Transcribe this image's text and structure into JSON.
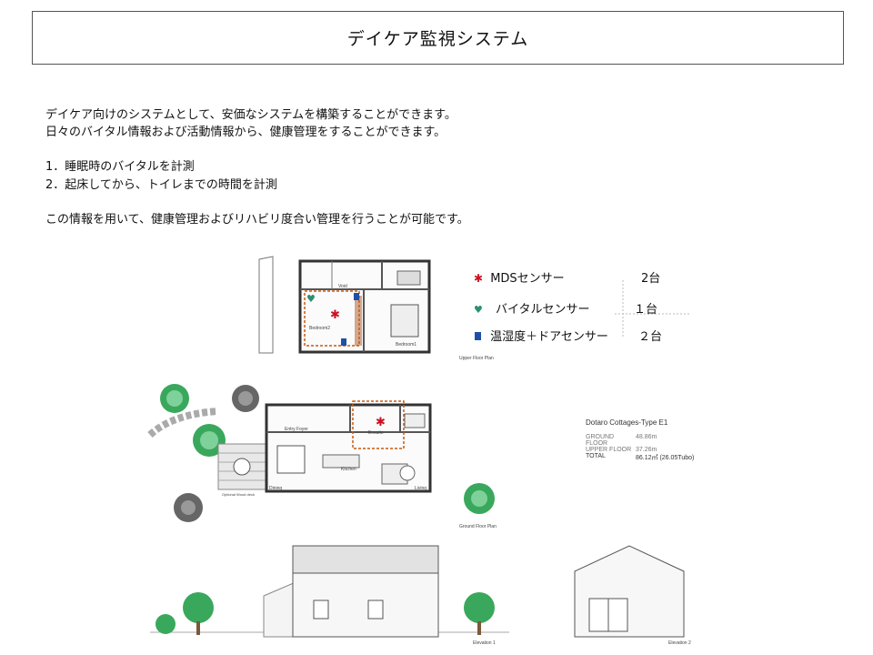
{
  "title": "デイケア監視システム",
  "intro": {
    "line1": "デイケア向けのシステムとして、安価なシステムを構築することができます。",
    "line2": "日々のバイタル情報および活動情報から、健康管理をすることができます。",
    "item1": "1．睡眠時のバイタルを計測",
    "item2": "2．起床してから、トイレまでの時間を計測",
    "closing": "この情報を用いて、健康管理およびリハビリ度合い管理を行うことが可能です。"
  },
  "legend": [
    {
      "icon": "mds-sensor-icon",
      "label": "MDSセンサー",
      "count": "2台",
      "color": "#cc1122"
    },
    {
      "icon": "vital-sensor-icon",
      "label": "バイタルセンサー",
      "count": "１台",
      "color": "#2a8f73"
    },
    {
      "icon": "temp-door-sensor-icon",
      "label": "温湿度＋ドアセンサー",
      "count": "２台",
      "color": "#1f4fa8"
    }
  ],
  "plan": {
    "upper_caption": "Upper Floor Plan",
    "ground_caption": "Ground Floor Plan",
    "room_bedroom2": "Bedroom2",
    "room_bedroom1": "Bedroom1",
    "room_void": "Void",
    "room_entry": "Entry Foyer",
    "room_ensuite": "Ensuite",
    "room_kitchen": "Kitchen",
    "room_dining": "Dining",
    "room_living": "Living",
    "deck": "Optional Wood deck",
    "elev1": "Elevation 1",
    "elev2": "Elevation 2"
  },
  "stats": {
    "heading": "Dotaro  Cottages-Type E1",
    "rows": [
      {
        "k": "GROUND FLOOR",
        "v": "48.86m"
      },
      {
        "k": "UPPER FLOOR",
        "v": "37.26m"
      },
      {
        "k": "TOTAL",
        "v": "86.12㎡ (26.05Tubo)"
      }
    ]
  }
}
